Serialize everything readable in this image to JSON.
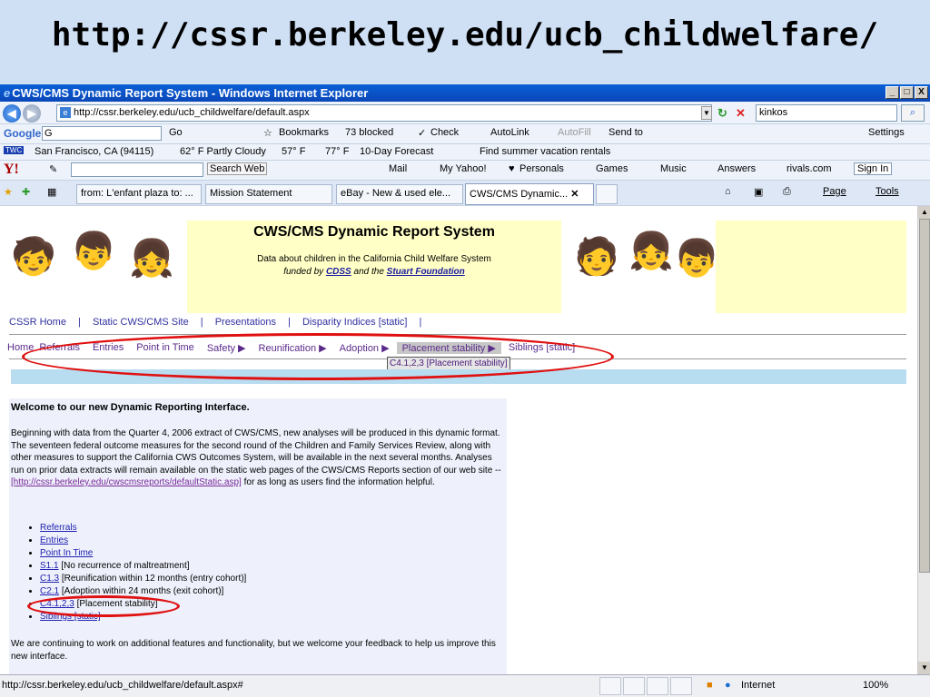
{
  "slide_title": "http://cssr.berkeley.edu/ucb_childwelfare/",
  "window": {
    "title": "CWS/CMS Dynamic Report System - Windows Internet Explorer",
    "min": "_",
    "max": "□",
    "close": "X"
  },
  "address": {
    "url": "http://cssr.berkeley.edu/ucb_childwelfare/default.aspx",
    "search_value": "kinkos"
  },
  "google_bar": {
    "logo": "Google",
    "input": "G",
    "go": "Go",
    "bookmarks": "Bookmarks",
    "blocked": "73 blocked",
    "check": "Check",
    "autolink": "AutoLink",
    "autofill": "AutoFill",
    "sendto": "Send to",
    "settings": "Settings"
  },
  "weather_bar": {
    "location": "San Francisco, CA (94115)",
    "temp1": "62° F Partly Cloudy",
    "temp2": "57° F",
    "temp3": "77° F",
    "forecast": "10-Day Forecast",
    "summer": "Find summer vacation rentals"
  },
  "yahoo_bar": {
    "logo": "Y!",
    "search_web": "Search Web",
    "mail": "Mail",
    "my_yahoo": "My Yahoo!",
    "personals": "Personals",
    "games": "Games",
    "music": "Music",
    "answers": "Answers",
    "rivals": "rivals.com",
    "sign_in": "Sign In"
  },
  "tabs": [
    {
      "label": "from: L'enfant plaza to: ..."
    },
    {
      "label": "Mission Statement"
    },
    {
      "label": "eBay - New & used ele..."
    },
    {
      "label": "CWS/CMS Dynamic..."
    }
  ],
  "tab_tools": {
    "page": "Page",
    "tools": "Tools"
  },
  "banner": {
    "title": "CWS/CMS Dynamic Report System",
    "sub1": "Data about children in the California Child Welfare System",
    "funded_by": "funded by",
    "cdss": "CDSS",
    "and_the": "and the",
    "stuart": "Stuart Foundation"
  },
  "top_links": [
    "CSSR Home",
    "|",
    "Static CWS/CMS Site",
    "|",
    "Presentations",
    "|",
    "Disparity Indices [static]",
    "|"
  ],
  "menu": {
    "home": "Home",
    "referrals": "Referrals",
    "entries": "Entries",
    "pit": "Point in Time",
    "safety": "Safety ▶",
    "reunification": "Reunification ▶",
    "adoption": "Adoption ▶",
    "placement": "Placement stability ▶",
    "siblings": "Siblings [static]"
  },
  "submenu": "C4.1,2,3 [Placement stability]",
  "panel": {
    "heading": "Welcome to our new Dynamic Reporting Interface.",
    "p1_a": "Beginning with data from the Quarter 4, 2006 extract of CWS/CMS, new analyses will be produced in this dynamic format. The seventeen federal outcome measures for the second round of the Children and Family Services Review, along with other measures to support the California CWS Outcomes System, will be available in the next several months. Analyses run on prior data extracts will remain available on the static web pages of the CWS/CMS Reports section of our web site -- ",
    "p1_link": "[http://cssr.berkeley.edu/cwscmsreports/defaultStatic.asp]",
    "p1_b": " for as long as users find the information helpful.",
    "items": [
      {
        "link": "Referrals",
        "rest": ""
      },
      {
        "link": "Entries",
        "rest": ""
      },
      {
        "link": "Point In Time",
        "rest": ""
      },
      {
        "link": "S1.1",
        "rest": " [No recurrence of maltreatment]"
      },
      {
        "link": "C1.3",
        "rest": " [Reunification within 12 months (entry cohort)]"
      },
      {
        "link": "C2.1",
        "rest": " [Adoption within 24 months (exit cohort)]"
      },
      {
        "link": "C4.1,2,3",
        "rest": " [Placement stability]"
      },
      {
        "link": "Siblings [static]",
        "rest": ""
      }
    ],
    "p2": "We are continuing to work on additional features and functionality, but we welcome your feedback to help us improve this new interface."
  },
  "status": {
    "url": "http://cssr.berkeley.edu/ucb_childwelfare/default.aspx#",
    "zone": "Internet",
    "zoom": "100%"
  }
}
